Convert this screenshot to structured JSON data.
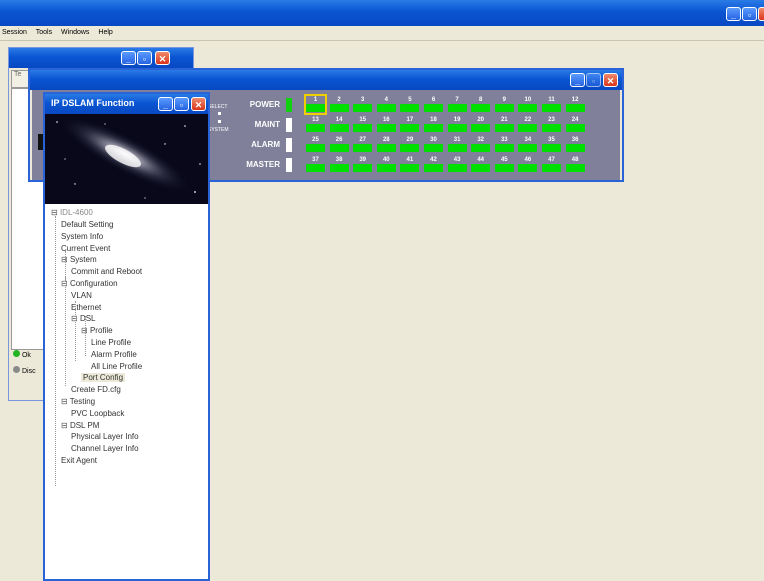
{
  "menu": {
    "items": [
      "Session",
      "Tools",
      "Windows",
      "Help"
    ]
  },
  "side_tab_label": "Te",
  "status_panel": {
    "items": [
      {
        "label": "Ok",
        "color": "#22B422"
      },
      {
        "label": "Disc",
        "color": "#8A8A8A"
      }
    ]
  },
  "dslam_window": {
    "title": "IP DSLAM Function"
  },
  "left_labels": {
    "select": "SELECT",
    "system": "SYSTEM"
  },
  "shelf": {
    "rows": [
      {
        "label": "POWER",
        "led": "on",
        "ports": [
          "1",
          "2",
          "3",
          "4",
          "5",
          "6",
          "7",
          "8",
          "9",
          "10",
          "11",
          "12"
        ]
      },
      {
        "label": "MAINT",
        "led": "off",
        "ports": [
          "13",
          "14",
          "15",
          "16",
          "17",
          "18",
          "19",
          "20",
          "21",
          "22",
          "23",
          "24"
        ]
      },
      {
        "label": "ALARM",
        "led": "off",
        "ports": [
          "25",
          "26",
          "27",
          "28",
          "29",
          "30",
          "31",
          "32",
          "33",
          "34",
          "35",
          "36"
        ]
      },
      {
        "label": "MASTER",
        "led": "off",
        "ports": [
          "37",
          "38",
          "39",
          "40",
          "41",
          "42",
          "43",
          "44",
          "45",
          "46",
          "47",
          "48"
        ]
      }
    ],
    "selected_port": "1",
    "port_color": "#00E000",
    "selected_color": "#F0D000"
  },
  "tree": {
    "root": "IDL-4600",
    "items": [
      {
        "label": "Default Setting",
        "toggle": ""
      },
      {
        "label": "System Info",
        "toggle": ""
      },
      {
        "label": "Current Event",
        "toggle": ""
      },
      {
        "label": "System",
        "toggle": "⊟"
      },
      {
        "label": "Commit and Reboot",
        "toggle": ""
      },
      {
        "label": "Configuration",
        "toggle": "⊟"
      },
      {
        "label": "VLAN",
        "toggle": ""
      },
      {
        "label": "Ethernet",
        "toggle": ""
      },
      {
        "label": "DSL",
        "toggle": "⊟"
      },
      {
        "label": "Profile",
        "toggle": "⊟"
      },
      {
        "label": "Line Profile",
        "toggle": ""
      },
      {
        "label": "Alarm Profile",
        "toggle": ""
      },
      {
        "label": "All Line Profile",
        "toggle": ""
      },
      {
        "label": "Port Config",
        "toggle": ""
      },
      {
        "label": "Create FD.cfg",
        "toggle": ""
      },
      {
        "label": "Testing",
        "toggle": "⊟"
      },
      {
        "label": "PVC Loopback",
        "toggle": ""
      },
      {
        "label": "DSL PM",
        "toggle": "⊟"
      },
      {
        "label": "Physical Layer Info",
        "toggle": ""
      },
      {
        "label": "Channel Layer Info",
        "toggle": ""
      },
      {
        "label": "Exit Agent",
        "toggle": ""
      }
    ]
  }
}
